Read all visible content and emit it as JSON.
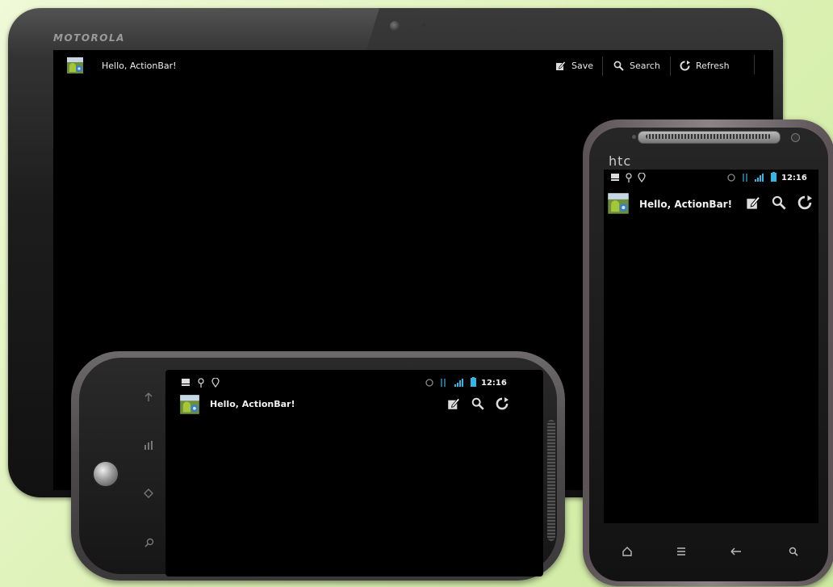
{
  "tablet": {
    "brand": "MOTOROLA",
    "app_title": "Hello, ActionBar!",
    "actions": [
      {
        "label": "Save",
        "icon": "edit-icon"
      },
      {
        "label": "Search",
        "icon": "search-icon"
      },
      {
        "label": "Refresh",
        "icon": "refresh-icon"
      }
    ]
  },
  "landscape_phone": {
    "app_title": "Hello, ActionBar!",
    "status": {
      "time": "12:16"
    },
    "actions": [
      {
        "icon": "edit-icon"
      },
      {
        "icon": "search-icon"
      },
      {
        "icon": "refresh-icon"
      }
    ],
    "hardware_buttons": [
      "back-icon",
      "menu-icon",
      "home-icon",
      "search-icon"
    ]
  },
  "portrait_phone": {
    "brand": "htc",
    "app_title": "Hello, ActionBar!",
    "status": {
      "time": "12:16"
    },
    "actions": [
      {
        "icon": "edit-icon"
      },
      {
        "icon": "search-icon"
      },
      {
        "icon": "refresh-icon"
      }
    ],
    "nav_buttons": [
      "home-icon",
      "menu-icon",
      "back-icon",
      "search-icon"
    ]
  },
  "colors": {
    "background": "#d9f0b0",
    "screen": "#000000",
    "signal": "#33b5e5",
    "text": "#f0f0f0"
  }
}
